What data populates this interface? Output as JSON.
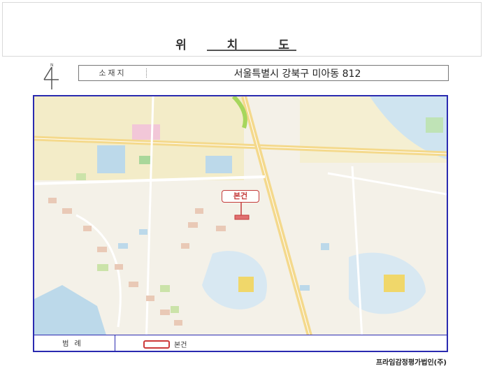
{
  "header": {
    "page_title": "위 치 도"
  },
  "location": {
    "label": "소재지",
    "address": "서울특별시 강북구 미아동 812"
  },
  "map": {
    "callout_label": "본건",
    "subject_color": "#cc3a3a",
    "border_color": "#2a2ab0"
  },
  "legend": {
    "title": "범례",
    "subject_label": "본건"
  },
  "footer": {
    "company": "프라임감정평가법인(주)"
  }
}
